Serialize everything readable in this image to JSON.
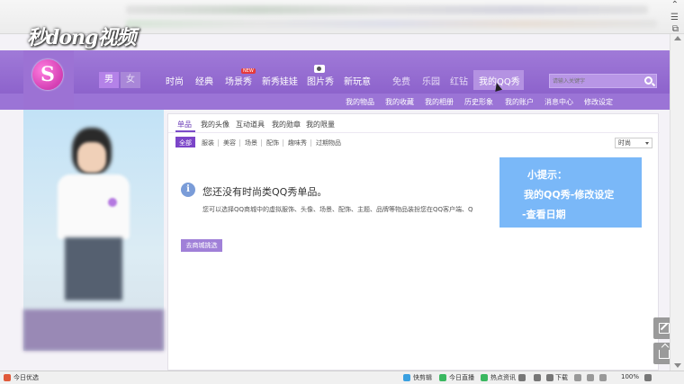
{
  "watermark": "秒dong视频",
  "window_controls": {
    "up": "⌃",
    "menu": "☰",
    "dup": "⧉"
  },
  "gender": {
    "male": "男",
    "female": "女"
  },
  "nav": {
    "items": [
      "时尚",
      "经典",
      "场景秀",
      "新秀娃娃",
      "图片秀",
      "新玩意",
      "免费",
      "乐园",
      "红钻",
      "我的QQ秀"
    ],
    "new_badge": "NEW"
  },
  "search": {
    "placeholder": "请输入关键字"
  },
  "subnav": {
    "items": [
      "我的物品",
      "我的收藏",
      "我的相册",
      "历史形象",
      "我的账户",
      "消息中心",
      "修改设定"
    ]
  },
  "tabs": [
    "单品",
    "我的头像",
    "互动道具",
    "我的勋章",
    "我的限量"
  ],
  "filters": [
    "全部",
    "服装",
    "美容",
    "场景",
    "配饰",
    "趣味秀",
    "过期物品"
  ],
  "sort": {
    "value": "时尚"
  },
  "empty": {
    "icon": "i",
    "title": "您还没有时尚类QQ秀单品。",
    "desc": "您可以选择QQ商城中的虚拟服饰、头像、场景、配饰、主题、品牌等物品装扮您在QQ客户端、Q"
  },
  "shop_button": "去商城挑选",
  "tip": {
    "line1": "小提示：",
    "line2": "我的QQ秀-修改设定",
    "line3": "-查看日期"
  },
  "status": {
    "left": "今日优选",
    "items": [
      "快剪辑",
      "今日直播",
      "热点资讯",
      "下载",
      "100%"
    ],
    "icons": {
      "kuaijianji": "#3aa0e0",
      "zhibo": "#3ab860",
      "redian": "#3ab860"
    }
  }
}
